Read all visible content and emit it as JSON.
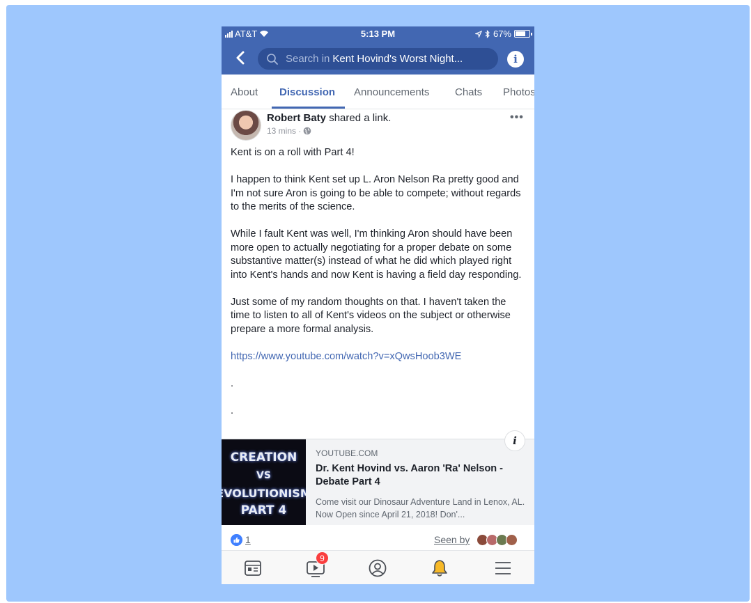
{
  "status_bar": {
    "carrier": "AT&T",
    "time": "5:13 PM",
    "battery": "67%"
  },
  "search": {
    "placeholder_prefix": "Search in",
    "group_name": "Kent Hovind's Worst Night..."
  },
  "tabs": [
    {
      "label": "About"
    },
    {
      "label": "Discussion",
      "active": true
    },
    {
      "label": "Announcements"
    },
    {
      "label": "Chats"
    },
    {
      "label": "Photos"
    }
  ],
  "post": {
    "author": "Robert Baty",
    "action": "shared a link.",
    "time": "13 mins ·",
    "paragraphs": [
      "Kent is on a roll with Part 4!",
      "I happen to think Kent set up L. Aron Nelson Ra pretty good and I'm not sure Aron is going to be able to compete; without regards to the merits of the science.",
      "While I fault Kent was well, I'm thinking Aron should have been more open to actually negotiating for a proper debate on some substantive matter(s) instead of what he did which played right into Kent's hands and now Kent is having a field day responding.",
      "Just some of my random thoughts on that.  I haven't taken the time to listen to all of Kent's videos on the subject or otherwise prepare a more formal analysis."
    ],
    "link": "https://www.youtube.com/watch?v=xQwsHoob3WE",
    "dot1": ".",
    "dot2": "."
  },
  "link_card": {
    "thumbnail": {
      "line1": "CREATION",
      "line2": "VS",
      "line3": "EVOLUTIONISM",
      "line4": "PART 4"
    },
    "info_glyph": "i",
    "source": "YOUTUBE.COM",
    "title": "Dr. Kent Hovind vs. Aaron 'Ra' Nelson - Debate Part 4",
    "description": "Come visit our Dinosaur Adventure Land in Lenox, AL. Now Open since April 21, 2018! Don'..."
  },
  "reactions": {
    "like_count": "1",
    "seen_by": "Seen by"
  },
  "bottom_nav": {
    "video_badge": "9"
  },
  "colors": {
    "brand": "#4267b2",
    "backdrop": "#9ec7fd",
    "badge": "#fa3e3e"
  },
  "icons": [
    "back-arrow-icon",
    "search-icon",
    "info-icon",
    "globe-icon",
    "more-icon",
    "like-icon",
    "news-feed-icon",
    "watch-icon",
    "profile-icon",
    "notifications-icon",
    "menu-icon"
  ]
}
